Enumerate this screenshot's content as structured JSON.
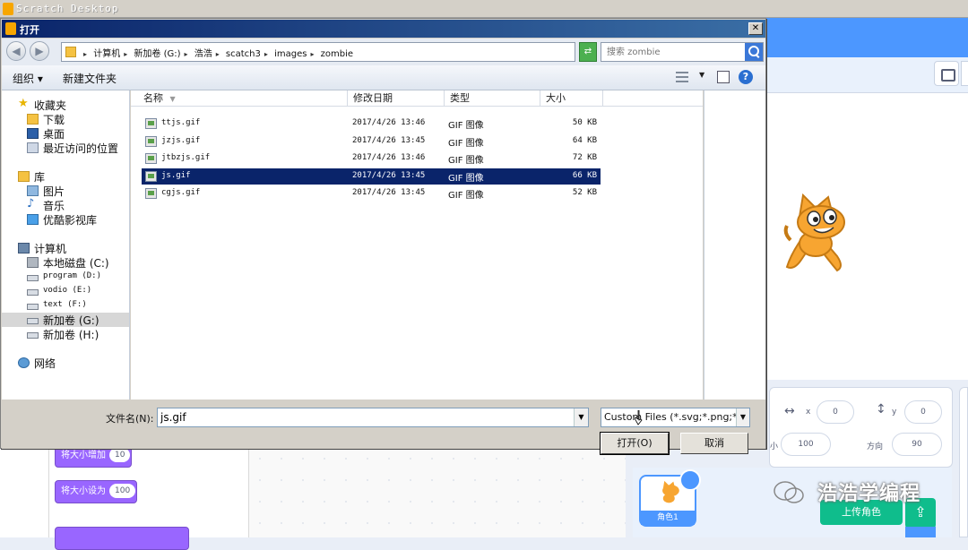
{
  "app": {
    "title": "Scratch Desktop"
  },
  "dialog": {
    "title": "打开",
    "close_glyph": "✕",
    "breadcrumb": [
      "计算机",
      "新加卷 (G:)",
      "浩浩",
      "scatch3",
      "images",
      "zombie"
    ],
    "search_placeholder": "搜索 zombie",
    "toolbar": {
      "organize": "组织 ▾",
      "new_folder": "新建文件夹",
      "help": "?"
    },
    "nav": {
      "favorites": "收藏夹",
      "downloads": "下载",
      "desktop": "桌面",
      "recent": "最近访问的位置",
      "libraries": "库",
      "pictures": "图片",
      "music": "音乐",
      "youku": "优酷影视库",
      "computer": "计算机",
      "drive_c": "本地磁盘 (C:)",
      "drive_d": "program (D:)",
      "drive_e": "vodio (E:)",
      "drive_f": "text (F:)",
      "drive_g": "新加卷 (G:)",
      "drive_h": "新加卷 (H:)",
      "network": "网络"
    },
    "columns": {
      "name": "名称",
      "date": "修改日期",
      "type": "类型",
      "size": "大小"
    },
    "files": [
      {
        "name": "ttjs.gif",
        "date": "2017/4/26 13:46",
        "type": "GIF 图像",
        "size": "50 KB"
      },
      {
        "name": "jzjs.gif",
        "date": "2017/4/26 13:45",
        "type": "GIF 图像",
        "size": "64 KB"
      },
      {
        "name": "jtbzjs.gif",
        "date": "2017/4/26 13:46",
        "type": "GIF 图像",
        "size": "72 KB"
      },
      {
        "name": "js.gif",
        "date": "2017/4/26 13:45",
        "type": "GIF 图像",
        "size": "66 KB"
      },
      {
        "name": "cgjs.gif",
        "date": "2017/4/26 13:45",
        "type": "GIF 图像",
        "size": "52 KB"
      }
    ],
    "selected_file_index": 3,
    "filename_label": "文件名(N):",
    "filename_value": "js.gif",
    "filetype_value": "Custom Files (*.svg;*.png;*.jp",
    "open_label": "打开(O)",
    "cancel_label": "取消"
  },
  "scratch": {
    "blocks": [
      {
        "text": "将大小增加",
        "value": "10"
      },
      {
        "text": "将大小设为",
        "value": "100"
      }
    ],
    "sprite_info": {
      "x_label": "x",
      "x_value": "0",
      "y_label": "y",
      "y_value": "0",
      "size_label": "小",
      "size_value": "100",
      "direction_label": "方向",
      "direction_value": "90"
    },
    "sprite_name": "角色1",
    "upload_label": "上传角色",
    "watermark": "浩浩学编程"
  },
  "colors": {
    "scratch_blue": "#4c97ff",
    "looks_purple": "#9966ff",
    "upload_green": "#0fbd8c",
    "selection": "#0a246a"
  }
}
